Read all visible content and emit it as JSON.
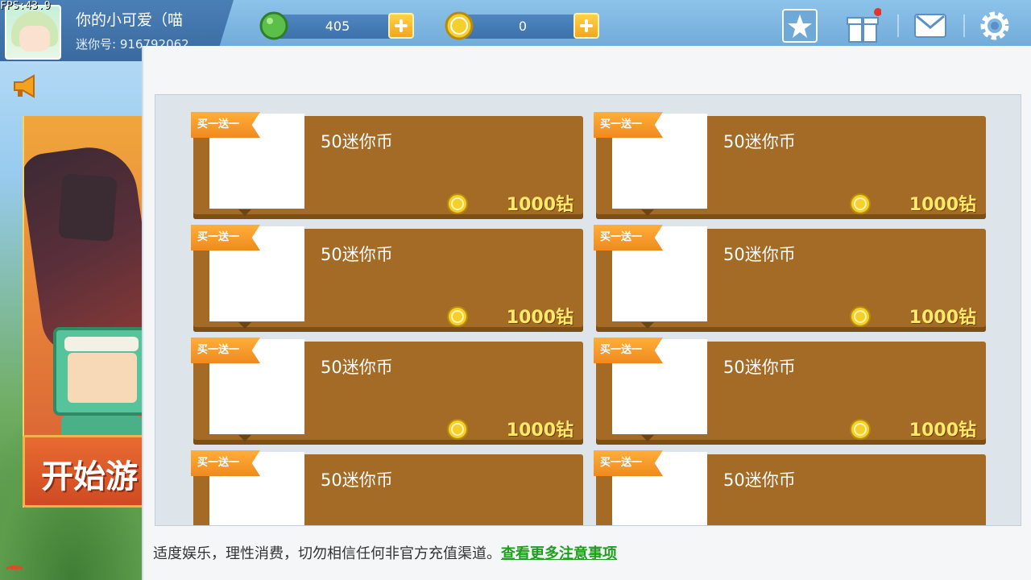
{
  "fps": "FPS:43.9",
  "profile": {
    "name": "你的小可爱（喵",
    "id_text": "迷你号: 916792062"
  },
  "currencies": [
    {
      "name": "green-gem",
      "value": "405",
      "color": "#4caf50"
    },
    {
      "name": "mini-coin",
      "value": "0",
      "color": "#f2c21a"
    }
  ],
  "start_button": "开始游",
  "shop": {
    "cards": [
      {
        "ribbon": "买一送一",
        "title": "50迷你币",
        "price": "1000钻"
      },
      {
        "ribbon": "买一送一",
        "title": "50迷你币",
        "price": "1000钻"
      },
      {
        "ribbon": "买一送一",
        "title": "50迷你币",
        "price": "1000钻"
      },
      {
        "ribbon": "买一送一",
        "title": "50迷你币",
        "price": "1000钻"
      },
      {
        "ribbon": "买一送一",
        "title": "50迷你币",
        "price": "1000钻"
      },
      {
        "ribbon": "买一送一",
        "title": "50迷你币",
        "price": "1000钻"
      },
      {
        "ribbon": "买一送一",
        "title": "50迷你币",
        "price": ""
      },
      {
        "ribbon": "买一送一",
        "title": "50迷你币",
        "price": ""
      }
    ],
    "notice_text": "适度娱乐，理性消费，切勿相信任何非官方充值渠道。",
    "notice_link": "查看更多注意事项"
  },
  "icons": {
    "favorites": "star-icon",
    "gift": "gift-icon",
    "mail": "mail-icon",
    "settings": "gear-icon"
  },
  "colors": {
    "card_bg": "#a36b25",
    "price": "#ffe96a",
    "ribbon": "#f08a1e",
    "link": "#1f9e1f"
  }
}
